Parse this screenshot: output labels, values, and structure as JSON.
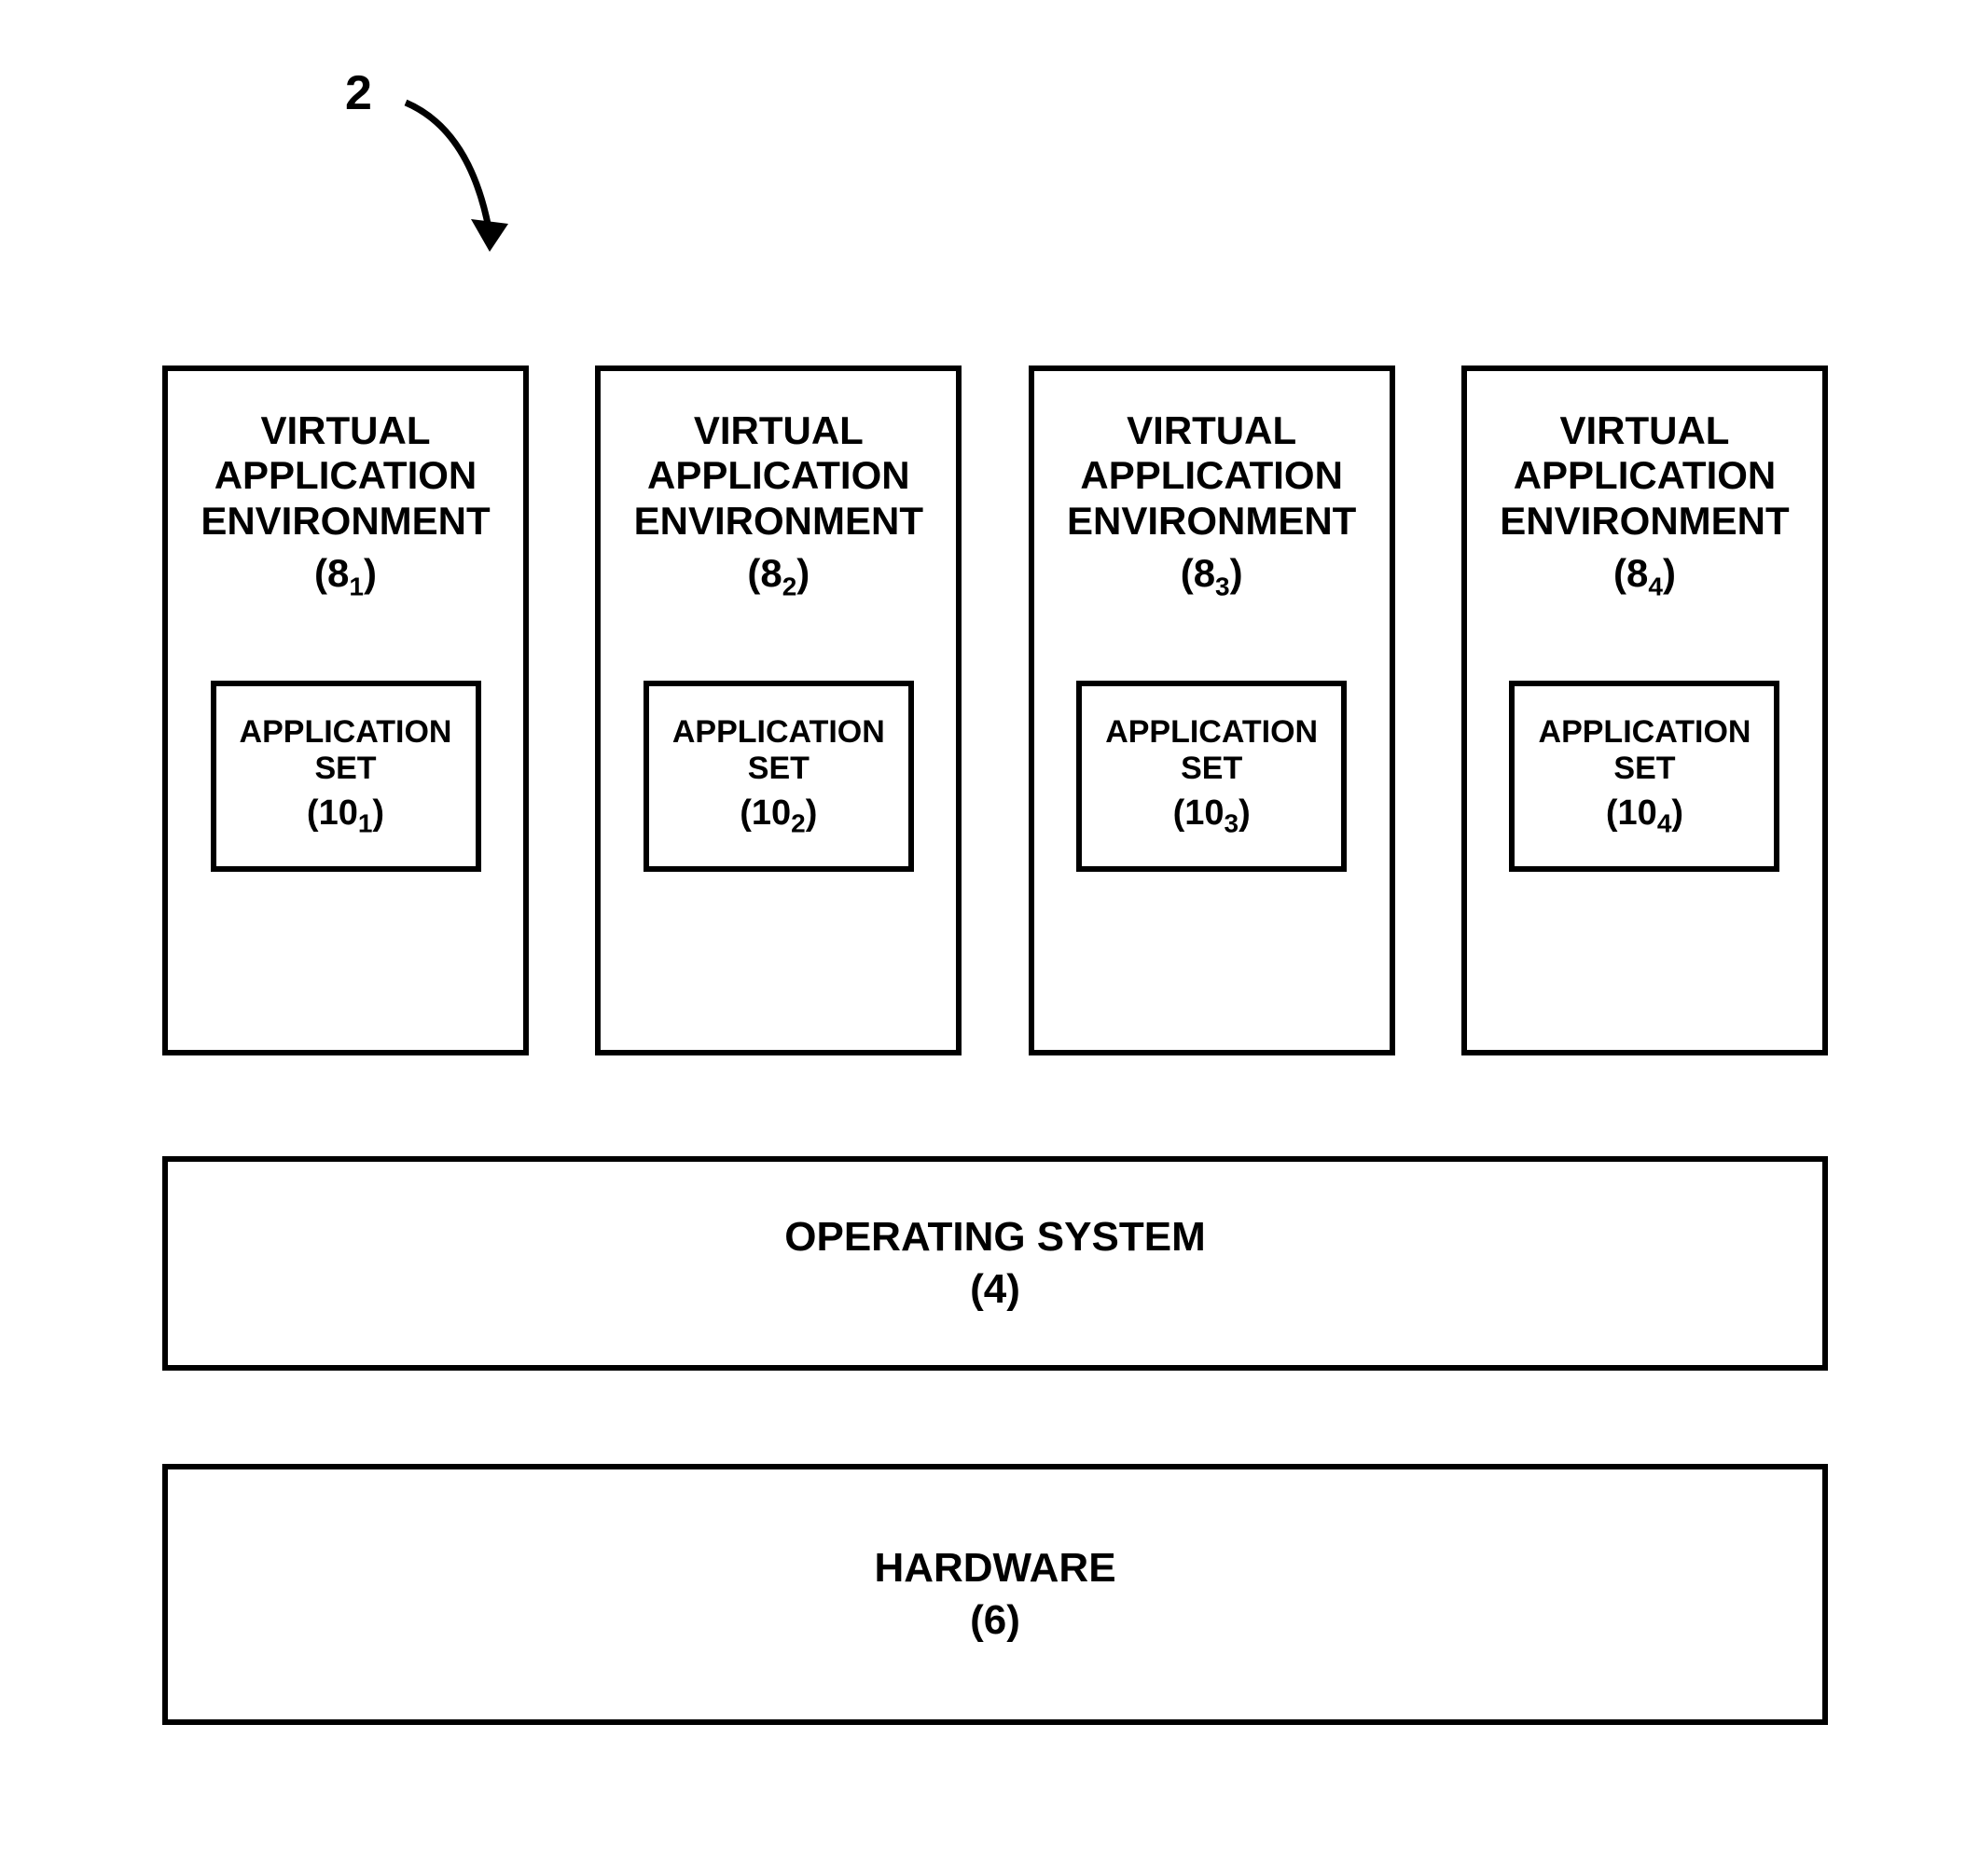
{
  "diagram_ref": "2",
  "vae": {
    "title_line1": "VIRTUAL",
    "title_line2": "APPLICATION",
    "title_line3": "ENVIRONMENT",
    "ref_base": "8",
    "app_title_line1": "APPLICATION",
    "app_title_line2": "SET",
    "app_ref_base": "10",
    "items": [
      {
        "sub": "1"
      },
      {
        "sub": "2"
      },
      {
        "sub": "3"
      },
      {
        "sub": "4"
      }
    ]
  },
  "os": {
    "title": "OPERATING SYSTEM",
    "ref": "(4)"
  },
  "hw": {
    "title": "HARDWARE",
    "ref": "(6)"
  }
}
